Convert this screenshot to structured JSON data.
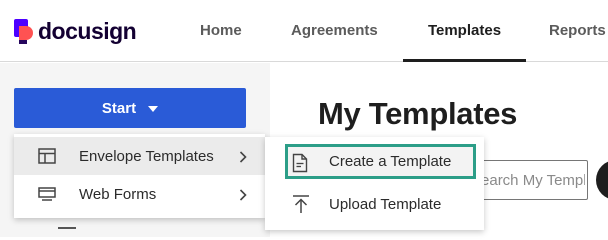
{
  "app": {
    "name": "docusign"
  },
  "nav": {
    "tabs": [
      {
        "label": "Home",
        "active": false
      },
      {
        "label": "Agreements",
        "active": false
      },
      {
        "label": "Templates",
        "active": true
      },
      {
        "label": "Reports",
        "active": false
      }
    ]
  },
  "sidebar": {
    "start_label": "Start"
  },
  "main": {
    "title": "My Templates",
    "search": {
      "placeholder": "Search My Templates"
    }
  },
  "start_menu": {
    "items": [
      {
        "label": "Envelope Templates",
        "icon": "layout-icon"
      },
      {
        "label": "Web Forms",
        "icon": "web-form-icon"
      }
    ]
  },
  "template_submenu": {
    "items": [
      {
        "label": "Create a Template",
        "icon": "document-icon"
      },
      {
        "label": "Upload Template",
        "icon": "upload-icon"
      }
    ]
  },
  "colors": {
    "primary_button": "#2a5bd7",
    "focus_ring": "#2c9e88",
    "brand_purple": "#4c00ff",
    "brand_coral": "#ff5252"
  }
}
